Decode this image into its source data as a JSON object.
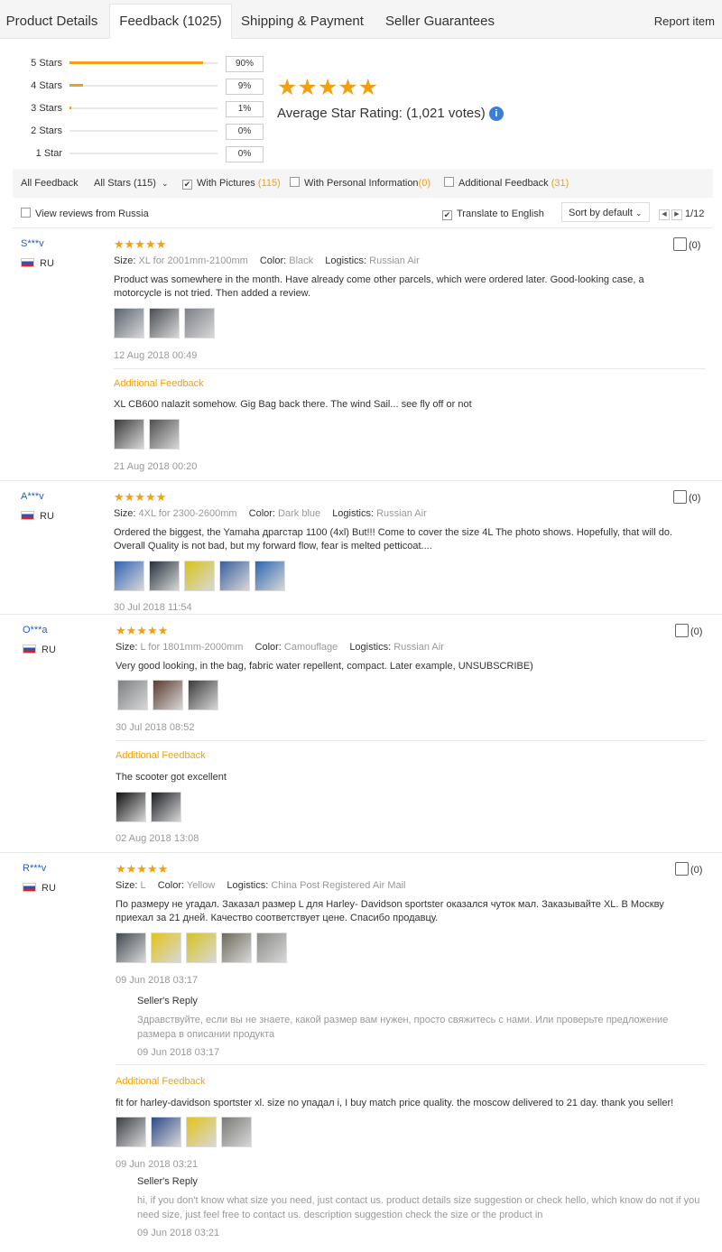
{
  "tabs": [
    {
      "label": "Product Details"
    },
    {
      "label": "Feedback (1025)"
    },
    {
      "label": "Shipping & Payment"
    },
    {
      "label": "Seller Guarantees"
    }
  ],
  "report_label": "Report item",
  "rating_rows": [
    {
      "label": "5 Stars",
      "pct": "90%",
      "fill": 0.9
    },
    {
      "label": "4 Stars",
      "pct": "9%",
      "fill": 0.09
    },
    {
      "label": "3 Stars",
      "pct": "1%",
      "fill": 0.01
    },
    {
      "label": "2 Stars",
      "pct": "0%",
      "fill": 0
    },
    {
      "label": "1 Star",
      "pct": "0%",
      "fill": 0
    }
  ],
  "average": {
    "stars": "★★★★★",
    "label": "Average Star Rating:",
    "votes": "(1,021 votes)",
    "info": "i"
  },
  "filters": {
    "all_feedback": "All Feedback",
    "all_stars": "All Stars (115)",
    "with_pictures": "With Pictures",
    "with_pictures_count": "(115)",
    "personal_info": "With Personal Information",
    "personal_info_count": "(0)",
    "additional": "Additional Feedback",
    "additional_count": "(31)"
  },
  "options": {
    "view_russia": "View reviews from Russia",
    "translate": "Translate to English",
    "sort": "Sort by default",
    "page": "1/12"
  },
  "reviews": [
    {
      "user": "S***v",
      "country": "RU",
      "likes": "(0)",
      "stars": "★★★★★",
      "meta": [
        [
          "Size:",
          "XL for 2001mm-2100mm"
        ],
        [
          "Color:",
          "Black"
        ],
        [
          "Logistics:",
          "Russian Air"
        ]
      ],
      "text": "Product was somewhere in the month. Have already come other parcels, which were ordered later. Good-looking case, a motorcycle is not tried. Then added a review.",
      "date": "12 Aug 2018 00:49",
      "additional_label": "Additional Feedback",
      "additional_text": "XL CB600 nalazit somehow. Gig Bag back there. The wind Sail... see fly off or not",
      "additional_date": "21 Aug 2018 00:20"
    },
    {
      "user": "A***v",
      "country": "RU",
      "likes": "(0)",
      "stars": "★★★★★",
      "meta": [
        [
          "Size:",
          "4XL for 2300-2600mm"
        ],
        [
          "Color:",
          "Dark blue"
        ],
        [
          "Logistics:",
          "Russian Air"
        ]
      ],
      "text": "Ordered the biggest, the Yamaha драгстар 1100 (4xl) But!!! Come to cover the size 4L The photo shows. Hopefully, that will do. Overall Quality is not bad, but my forward flow, fear is melted petticoat....",
      "date": "30 Jul 2018 11:54"
    },
    {
      "user": "O***a",
      "country": "RU",
      "likes": "(0)",
      "stars": "★★★★★",
      "meta": [
        [
          "Size:",
          "L for 1801mm-2000mm"
        ],
        [
          "Color:",
          "Camouflage"
        ],
        [
          "Logistics:",
          "Russian Air"
        ]
      ],
      "text": "Very good looking, in the bag, fabric water repellent, compact. Later example, UNSUBSCRIBE)",
      "date": "30 Jul 2018 08:52",
      "additional_label": "Additional Feedback",
      "additional_text": "The scooter got excellent",
      "additional_date": "02 Aug 2018 13:08"
    },
    {
      "user": "R***v",
      "country": "RU",
      "likes": "(0)",
      "stars": "★★★★★",
      "meta": [
        [
          "Size:",
          "L"
        ],
        [
          "Color:",
          "Yellow"
        ],
        [
          "Logistics:",
          "China Post Registered Air Mail"
        ]
      ],
      "text": "По размеру не угадал. Заказал размер L для Harley- Davidson sportster оказался чуток мал. Заказывайте XL. В Москву приехал за 21 дней. Качество соответствует цене. Спасибо продавцу.",
      "date": "09 Jun 2018 03:17",
      "reply_title": "Seller's Reply",
      "reply_text": "Здравствуйте, если вы не знаете, какой размер вам нужен, просто свяжитесь с нами. Или проверьте предложение размера в описании продукта",
      "reply_date": "09 Jun 2018 03:17",
      "additional_label": "Additional Feedback",
      "additional_text": "fit for harley-davidson sportster xl. size no упадал i, I buy match price quality. the moscow delivered to 21 day. thank you seller!",
      "additional_date": "09 Jun 2018 03:21",
      "reply2_title": "Seller's Reply",
      "reply2_text": "hi, if you don't know what size you need, just contact us. product details size suggestion or check hello, which know do not if you need size, just feel free to contact us. description suggestion check the size or the product in",
      "reply2_date": "09 Jun 2018 03:21"
    }
  ],
  "photo_colors": {
    "r1": [
      "#5a6470",
      "#4a4e54",
      "#7c8088"
    ],
    "r1a": [
      "#3a3a3a",
      "#505050"
    ],
    "r2": [
      "#2f63b4",
      "#25303c",
      "#d9c21a",
      "#3a5f9e",
      "#2a66b0"
    ],
    "r3": [
      "#7d7f82",
      "#5c3a2e",
      "#3b3b3b"
    ],
    "r3a": [
      "#101010",
      "#1b1d22"
    ],
    "r4": [
      "#404a52",
      "#e2c31a",
      "#d8c220",
      "#6e6a5a",
      "#8a8a86"
    ],
    "r4a": [
      "#3a3e46",
      "#2f4a8a",
      "#e2c31a",
      "#7a7a76"
    ]
  }
}
